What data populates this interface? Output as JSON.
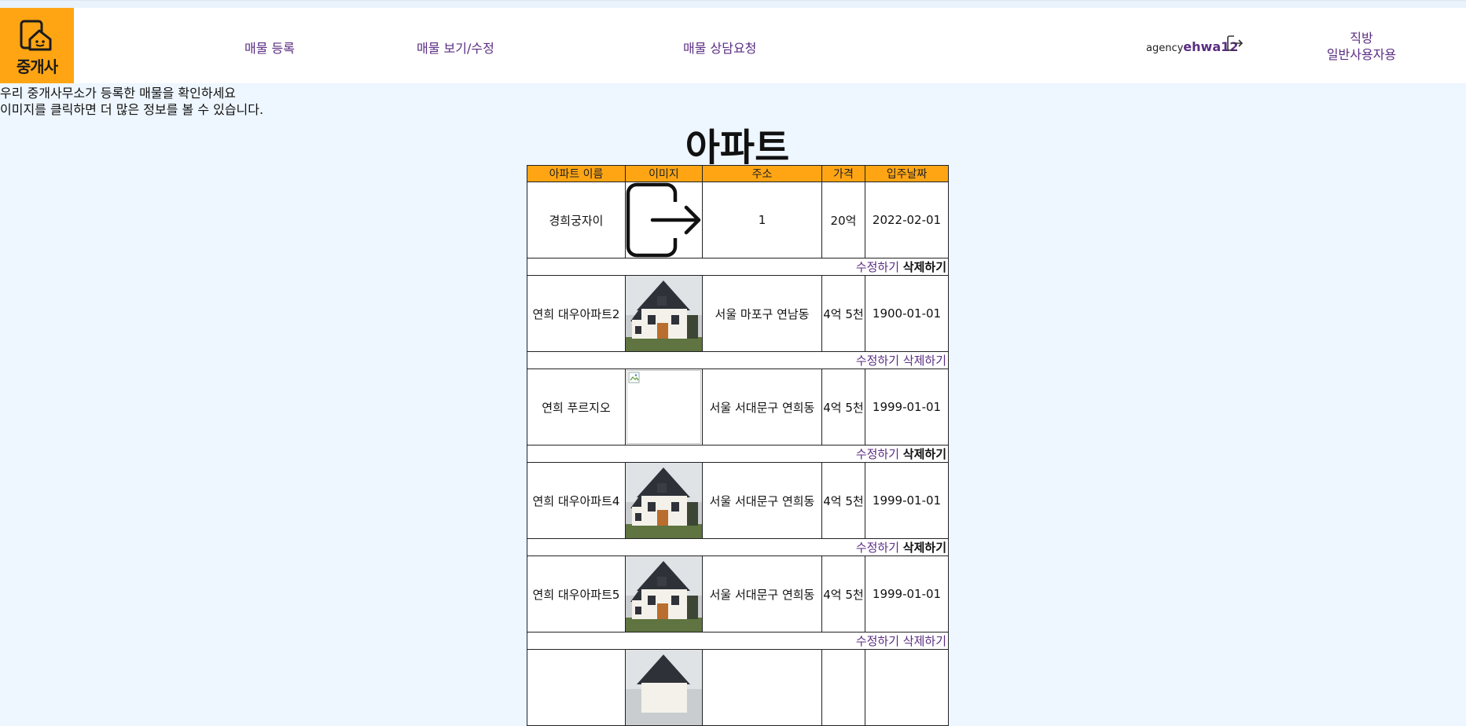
{
  "header": {
    "logo_text": "중개사",
    "nav": [
      {
        "label": "매물 등록"
      },
      {
        "label": "매물 보기/수정"
      },
      {
        "label": "매물 상담요청"
      }
    ],
    "user_prefix": "agency",
    "user_id": "ehwa12",
    "mode_line1": "직방",
    "mode_line2": "일반사용자용"
  },
  "intro": {
    "line1": "우리 중개사무소가 등록한 매물을 확인하세요",
    "line2": "이미지를 클릭하면 더 많은 정보를 볼 수 있습니다."
  },
  "page_title": "아파트",
  "table": {
    "headers": [
      "아파트 이름",
      "이미지",
      "주소",
      "가격",
      "입주날짜"
    ],
    "edit_label": "수정하기",
    "delete_label": "삭제하기",
    "rows": [
      {
        "name": "경희궁자이",
        "image": "logout-icon",
        "address": "1",
        "price": "20억",
        "date": "2022-02-01"
      },
      {
        "name": "연희 대우아파트2",
        "image": "house-photo",
        "address": "서울 마포구 연남동",
        "price": "4억 5천",
        "date": "1900-01-01"
      },
      {
        "name": "연희 푸르지오",
        "image": "broken-image",
        "address": "서울 서대문구 연희동",
        "price": "4억 5천",
        "date": "1999-01-01"
      },
      {
        "name": "연희 대우아파트4",
        "image": "house-photo",
        "address": "서울 서대문구 연희동",
        "price": "4억 5천",
        "date": "1999-01-01"
      },
      {
        "name": "연희 대우아파트5",
        "image": "house-photo",
        "address": "서울 서대문구 연희동",
        "price": "4억 5천",
        "date": "1999-01-01"
      },
      {
        "name": "",
        "image": "house-photo",
        "address": "",
        "price": "",
        "date": ""
      }
    ]
  },
  "colors": {
    "accent": "#ffa514",
    "link": "#5a2d82",
    "background": "#eef6ff"
  }
}
